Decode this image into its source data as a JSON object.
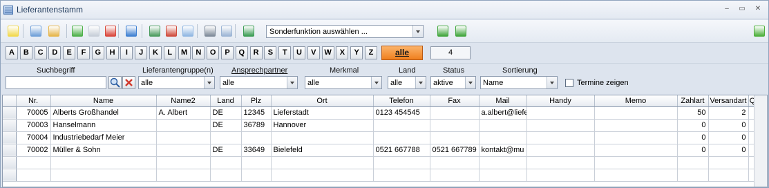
{
  "window": {
    "title": "Lieferantenstamm",
    "controls": [
      "–",
      "▭",
      "✕"
    ]
  },
  "toolbar": {
    "buttons": [
      {
        "name": "hint-bulb-button",
        "icon": "lightbulb-icon",
        "color": "#f2d84c"
      },
      {
        "name": "search-button",
        "icon": "magnifier-icon",
        "color": "#6f9fd8"
      },
      {
        "name": "search-folder-button",
        "icon": "folder-search-icon",
        "color": "#e6b54a"
      },
      {
        "name": "new-record-button",
        "icon": "add-icon",
        "color": "#4db04a"
      },
      {
        "name": "copy-record-button",
        "icon": "copy-icon",
        "color": "#c7ced8"
      },
      {
        "name": "delete-record-button",
        "icon": "delete-icon",
        "color": "#d9463b"
      },
      {
        "name": "statistics-button",
        "icon": "bar-chart-icon",
        "color": "#3d7fd1"
      },
      {
        "name": "add-contact-button",
        "icon": "contact-add-icon",
        "color": "#4a9b5e"
      },
      {
        "name": "add-appointment-button",
        "icon": "calendar-add-icon",
        "color": "#cf4b3c"
      },
      {
        "name": "email-button",
        "icon": "envelope-icon",
        "color": "#8fb6e2"
      },
      {
        "name": "print-button",
        "icon": "printer-icon",
        "color": "#7e8a99"
      },
      {
        "name": "grid-layout-button",
        "icon": "grid-icon",
        "color": "#9bb4d4"
      },
      {
        "name": "maps-button",
        "icon": "map-icon",
        "color": "#3a9c54"
      },
      {
        "name": "undo-button",
        "icon": "undo-arrow-icon",
        "color": "#3fa53b"
      },
      {
        "name": "refresh-button",
        "icon": "refresh-icon",
        "color": "#3fa53b"
      },
      {
        "name": "confirm-button",
        "icon": "checkmark-icon",
        "color": "#4caf3a"
      }
    ],
    "special_function": {
      "value": "Sonderfunktion auswählen ..."
    }
  },
  "alphabet": {
    "letters": [
      "A",
      "B",
      "C",
      "D",
      "E",
      "F",
      "G",
      "H",
      "I",
      "J",
      "K",
      "L",
      "M",
      "N",
      "O",
      "P",
      "Q",
      "R",
      "S",
      "T",
      "U",
      "V",
      "W",
      "X",
      "Y",
      "Z"
    ],
    "all_label": "alle",
    "count": "4",
    "accent_color": "#f07f1e"
  },
  "filters": {
    "search_label": "Suchbegriff",
    "search_value": "",
    "group_label": "Lieferantengruppe(n)",
    "group_value": "alle",
    "contact_label": "Ansprechpartner",
    "contact_value": "alle",
    "attribute_label": "Merkmal",
    "attribute_value": "alle",
    "country_label": "Land",
    "country_value": "alle",
    "status_label": "Status",
    "status_value": "aktive",
    "sort_label": "Sortierung",
    "sort_value": "Name",
    "appointments_label": "Termine zeigen",
    "appointments_checked": false
  },
  "table": {
    "columns": [
      "Nr.",
      "Name",
      "Name2",
      "Land",
      "Plz",
      "Ort",
      "Telefon",
      "Fax",
      "Mail",
      "Handy",
      "Memo",
      "Zahlart",
      "Versandart",
      "QM-Note"
    ],
    "rows": [
      [
        "70005",
        "Alberts Großhandel",
        "A. Albert",
        "DE",
        "12345",
        "Lieferstadt",
        "0123 454545",
        "",
        "a.albert@liefe",
        "",
        "",
        "50",
        "2",
        ""
      ],
      [
        "70003",
        "Hanselmann",
        "",
        "DE",
        "36789",
        "Hannover",
        "",
        "",
        "",
        "",
        "",
        "0",
        "0",
        ""
      ],
      [
        "70004",
        "Industriebedarf Meier",
        "",
        "",
        "",
        "",
        "",
        "",
        "",
        "",
        "",
        "0",
        "0",
        ""
      ],
      [
        "70002",
        "Müller & Sohn",
        "",
        "DE",
        "33649",
        "Bielefeld",
        "0521 667788",
        "0521 667789",
        "kontakt@mu",
        "",
        "",
        "0",
        "0",
        ""
      ]
    ],
    "empty_rows": 2
  }
}
